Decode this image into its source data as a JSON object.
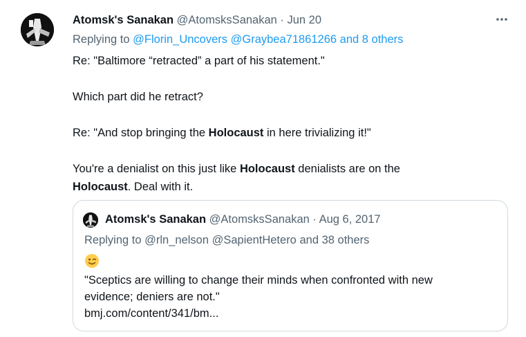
{
  "tweet": {
    "author_name": "Atomsk's Sanakan",
    "author_handle": "@AtomsksSanakan",
    "separator": " · ",
    "date": "Jun 20",
    "more_icon": "more-horizontal-icon",
    "replying_to_label": "Replying to ",
    "replying_to_user1": "@Florin_Uncovers",
    "replying_to_user2": "@Graybea71861266",
    "replying_to_others": "and 8 others",
    "body": {
      "line1": "Re: \"Baltimore “retracted” a part of his statement.\"",
      "line2": "Which part did he retract?",
      "line3_pre": "Re: \"And stop bringing the ",
      "line3_bold": "Holocaust",
      "line3_post": " in here trivializing it!\"",
      "line4_pre": "You're a denialist on this just like ",
      "line4_bold": "Holocaust",
      "line4_post": " denialists are on the",
      "line5_bold": "Holocaust",
      "line5_post": ". Deal with it."
    }
  },
  "quoted_tweet": {
    "author_name": "Atomsk's Sanakan",
    "author_handle": "@AtomsksSanakan",
    "separator": " · ",
    "date": "Aug 6, 2017",
    "replying_to_label": "Replying to ",
    "replying_to_user1": "@rln_nelson",
    "replying_to_user2": "@SapientHetero",
    "replying_to_others": "and 38 others",
    "emoji_icon": "winking-face-icon",
    "text_line1": "\"Sceptics are willing to change their minds when confronted with new",
    "text_line2": "evidence; deniers are not.\"",
    "link_text": "bmj.com/content/341/bm..."
  },
  "colors": {
    "accent": "#1d9bf0",
    "muted": "#536471",
    "border": "#cfd9de",
    "text": "#0f1419"
  }
}
